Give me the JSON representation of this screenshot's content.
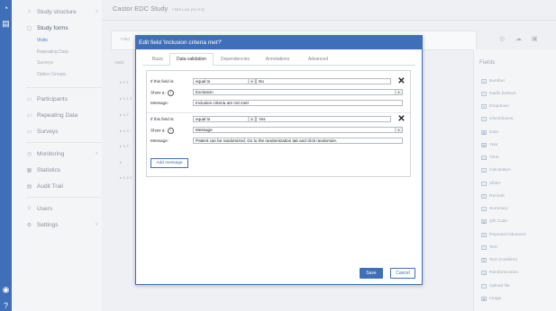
{
  "sidebar": {
    "items": [
      {
        "label": "Study structure",
        "icon": "structure-icon"
      },
      {
        "label": "Study forms",
        "icon": "forms-icon"
      },
      {
        "label": "Participants",
        "icon": "participants-icon"
      },
      {
        "label": "Repeating Data",
        "icon": "repeating-icon"
      },
      {
        "label": "Surveys",
        "icon": "surveys-icon"
      },
      {
        "label": "Monitoring",
        "icon": "monitoring-icon"
      },
      {
        "label": "Statistics",
        "icon": "statistics-icon"
      },
      {
        "label": "Audit Trail",
        "icon": "audit-icon"
      },
      {
        "label": "Users",
        "icon": "users-icon"
      },
      {
        "label": "Settings",
        "icon": "settings-icon"
      }
    ],
    "subitems": [
      "Visits",
      "Repeating Data",
      "Surveys",
      "Option Groups"
    ]
  },
  "header": {
    "study_title": "Castor EDC Study",
    "study_status": "• Not Live (v1.0.1)"
  },
  "background": {
    "form_label": "Field",
    "tabs": "Visits",
    "rows": [
      "1.1",
      "1.1.1",
      "1.2",
      "1.3",
      "1.4",
      "",
      "1.4.1"
    ]
  },
  "fields_panel": {
    "title": "Fields",
    "items": [
      "Number",
      "Radio buttons",
      "Dropdown",
      "Checkboxes",
      "Date",
      "Year",
      "Time",
      "Calculation",
      "Slider",
      "Remark",
      "Summary",
      "QR Code",
      "Repeated Measure",
      "Text",
      "Text (multiline)",
      "Randomization",
      "Upload file",
      "Image"
    ]
  },
  "dialog": {
    "title": "Edit field 'Inclusion criteria met?'",
    "tabs": [
      "Basic",
      "Data validation",
      "Dependencies",
      "Annotations",
      "Advanced"
    ],
    "active_tab": "Data validation",
    "rules": [
      {
        "if_label": "If this field is:",
        "operator": "equal to",
        "value": "No",
        "show_label": "Show a:",
        "show_value": "Exclusion",
        "message_label": "Message:",
        "message": "Inclusion criteria are not met!"
      },
      {
        "if_label": "If this field is:",
        "operator": "equal to",
        "value": "Yes",
        "show_label": "Show a:",
        "show_value": "Message",
        "message_label": "Message:",
        "message": "Patient can be randomized. Go to the randomization tab and click randomize."
      }
    ],
    "add_message": "Add message",
    "save": "Save",
    "cancel": "Cancel"
  },
  "colors": {
    "accent": "#3e6fb8",
    "sidebar_bg": "#f4f5f7",
    "rail_bg": "#3e6fb8"
  }
}
